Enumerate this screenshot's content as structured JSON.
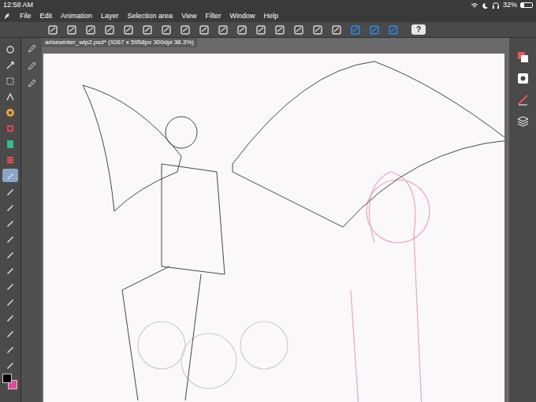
{
  "status_bar": {
    "time": "12:58 AM",
    "battery": "32%",
    "battery_level": 0.32
  },
  "menu": [
    "File",
    "Edit",
    "Animation",
    "Layer",
    "Selection area",
    "View",
    "Filter",
    "Window",
    "Help"
  ],
  "toolbar": {
    "toggles": [
      {
        "on": false
      },
      {
        "on": false
      },
      {
        "on": false
      },
      {
        "on": false
      },
      {
        "on": false
      },
      {
        "on": false
      },
      {
        "on": false
      },
      {
        "on": false
      },
      {
        "on": false
      },
      {
        "on": false
      },
      {
        "on": false
      },
      {
        "on": false
      },
      {
        "on": false
      },
      {
        "on": false
      },
      {
        "on": false
      },
      {
        "on": false
      },
      {
        "on": true
      },
      {
        "on": true
      },
      {
        "on": true
      }
    ],
    "help": "?"
  },
  "document": {
    "title": "arisewinter_wip2.psd* (9267 x 5958px 300dpi 38.3%)"
  },
  "tools": [
    {
      "selected": false
    },
    {
      "selected": false
    },
    {
      "selected": false
    },
    {
      "selected": false
    },
    {
      "selected": false
    },
    {
      "selected": false
    },
    {
      "selected": false
    },
    {
      "selected": false
    },
    {
      "selected": true
    },
    {
      "selected": false
    },
    {
      "selected": false
    },
    {
      "selected": false
    },
    {
      "selected": false
    },
    {
      "selected": false
    },
    {
      "selected": false
    },
    {
      "selected": false
    },
    {
      "selected": false
    },
    {
      "selected": false
    },
    {
      "selected": false
    },
    {
      "selected": false
    },
    {
      "selected": false
    }
  ],
  "colors": [
    {
      "color": "#000000"
    },
    {
      "color": "#e0489c"
    }
  ]
}
